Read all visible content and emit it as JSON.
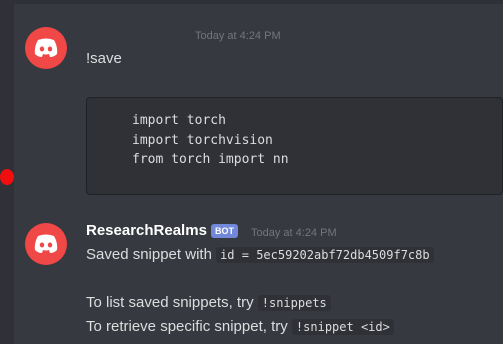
{
  "messages": [
    {
      "author": "",
      "timestamp": "Today at 4:24 PM",
      "text": "!save",
      "code_lines": [
        "import torch",
        "import torchvision",
        "from torch import nn"
      ]
    },
    {
      "author": "ResearchRealms",
      "badge": "BOT",
      "timestamp": "Today at 4:24 PM",
      "line1_prefix": "Saved snippet with ",
      "line1_code": "id = 5ec59202abf72db4509f7c8b",
      "line2_prefix": "To list saved snippets, try ",
      "line2_code": "!snippets",
      "line3_prefix": "To retrieve specific snippet, try ",
      "line3_code": "!snippet <id>"
    }
  ],
  "colors": {
    "background": "#36393f",
    "avatar": "#f04747",
    "bot_badge": "#7289da",
    "unread_indicator": "#f20e0e"
  },
  "icons": [
    "discord-logo-icon"
  ]
}
